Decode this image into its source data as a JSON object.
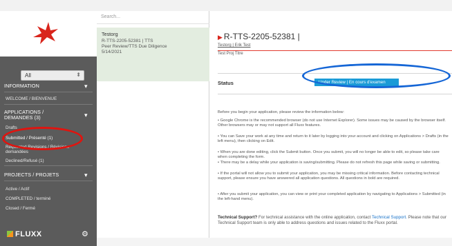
{
  "sidebar": {
    "filter_value": "All",
    "sections": [
      {
        "label": "INFORMATION",
        "items": [
          "WELCOME / BIENVENUE"
        ]
      },
      {
        "label": "APPLICATIONS / DEMANDES (3)",
        "items": [
          "Drafts",
          "Submitted / Présenté (1)",
          "Requested Revisions / Révisions demandées",
          "Declined/Refusé (1)"
        ]
      },
      {
        "label": "PROJECTS / PROJETS",
        "items": [
          "Active / Actif",
          "COMPLETED / terminé",
          "Closed / Fermé"
        ]
      }
    ],
    "brand": "FLUXX"
  },
  "list": {
    "search_placeholder": "Search...",
    "card": {
      "title": "Testorg",
      "lines": [
        "R-TTS-2205-52381 | TTS",
        "Peer Review/TTS Due Diligence",
        "5/14/2021"
      ]
    }
  },
  "main": {
    "record_title": "R-TTS-2205-52381 |",
    "org_line": "Testorg | Erik Test",
    "project_title": "Test Proj Titre",
    "status_label": "Status",
    "status_value": "Under Review | En cours d'examen",
    "intro": "Before you begin your application, please review the information below:",
    "bullets": [
      "• Google Chrome is the recommended browser (do not use Internet Explorer). Some issues may be caused by the browser itself. Other browsers may or may not support all Fluxx features.",
      "• You can Save your work at any time and return to it later by logging into your account and clicking on Applications > Drafts (in the left menu), then clicking on Edit.",
      "• When you are done editing, click the Submit button. Once you submit, you will no longer be able to edit, so please take care when completing the form.",
      "• There may be a delay while your application is saving/submitting. Please do not refresh this page while saving or submitting.",
      "• If the portal will not allow you to submit your application, you may be missing critical information. Before contacting technical support, please ensure you have answered all application questions. All questions in bold are required.",
      "• After you submit your application, you can view or print your completed application by navigating to Applications > Submitted (in the left-hand menu)."
    ],
    "tech_label": "Technical Support?",
    "tech_text": "For technical assistance with the online application, contact",
    "tech_link": "Technical Support.",
    "tech_tail": "Please note that our Technical Support team is only able to address questions and issues related to the Fluxx portal."
  },
  "colors": {
    "sidebar": "#5b5b5b",
    "card": "#e3ede0",
    "status": "#1a9bd7",
    "annotation_red": "#e0140f",
    "annotation_blue": "#1566d6"
  }
}
